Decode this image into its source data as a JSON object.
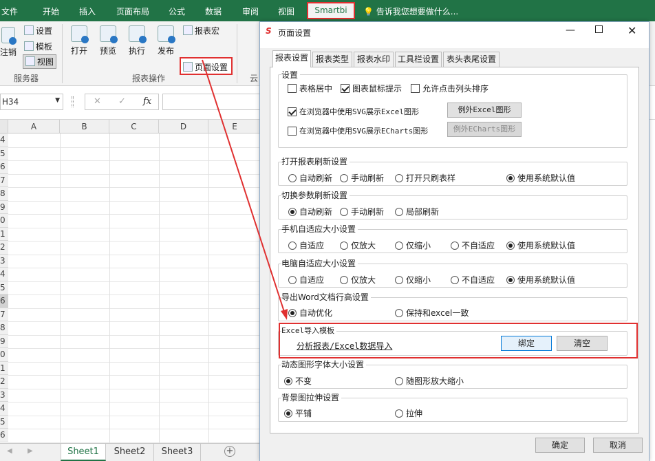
{
  "ribbon_tabs": [
    "文件",
    "开始",
    "插入",
    "页面布局",
    "公式",
    "数据",
    "审阅",
    "视图"
  ],
  "active_tab": "Smartbi",
  "tell_me": "告诉我您想要做什么...",
  "ribbon": {
    "logout": "注销",
    "settings": "设置",
    "template": "模板",
    "view": "视图",
    "group_server": "服务器",
    "open": "打开",
    "preview": "预览",
    "execute": "执行",
    "publish": "发布",
    "report_macro": "报表宏",
    "page_setup": "页面设置",
    "group_report_ops": "报表操作",
    "cloud_initial": "云"
  },
  "name_box": "H34",
  "fx": "fx",
  "columns": [
    "A",
    "B",
    "C",
    "D",
    "E"
  ],
  "row_numbers": [
    "4",
    "5",
    "6",
    "7",
    "8",
    "9",
    "0",
    "1",
    "2",
    "3",
    "4",
    "5",
    "6",
    "7",
    "8",
    "9",
    "0",
    "1",
    "2",
    "3",
    "4",
    "5",
    "6"
  ],
  "sheets": [
    "Sheet1",
    "Sheet2",
    "Sheet3"
  ],
  "dialog": {
    "title": "页面设置",
    "tabs": [
      "报表设置",
      "报表类型",
      "报表水印",
      "工具栏设置",
      "表头表尾设置"
    ],
    "settings_group": "设置",
    "chk_center": "表格居中",
    "chk_tooltip": "图表鼠标提示",
    "chk_sort": "允许点击列头排序",
    "chk_svg_excel": "在浏览器中使用SVG展示Excel图形",
    "btn_except_excel": "例外Excel图形",
    "chk_svg_echarts": "在浏览器中使用SVG展示ECharts图形",
    "btn_except_echarts": "例外ECharts图形",
    "open_refresh": {
      "label": "打开报表刷新设置",
      "opts": [
        "自动刷新",
        "手动刷新",
        "打开只刷表样",
        "使用系统默认值"
      ]
    },
    "param_refresh": {
      "label": "切换参数刷新设置",
      "opts": [
        "自动刷新",
        "手动刷新",
        "局部刷新"
      ]
    },
    "mobile_fit": {
      "label": "手机自适应大小设置",
      "opts": [
        "自适应",
        "仅放大",
        "仅缩小",
        "不自适应",
        "使用系统默认值"
      ]
    },
    "pc_fit": {
      "label": "电脑自适应大小设置",
      "opts": [
        "自适应",
        "仅放大",
        "仅缩小",
        "不自适应",
        "使用系统默认值"
      ]
    },
    "word_export": {
      "label": "导出Word文档行高设置",
      "opts": [
        "自动优化",
        "保持和excel一致"
      ]
    },
    "excel_import": {
      "label": "Excel导入模板",
      "link": "分析报表/Excel数据导入",
      "bind": "绑定",
      "clear": "清空"
    },
    "chart_font": {
      "label": "动态图形字体大小设置",
      "opts": [
        "不变",
        "随图形放大缩小"
      ]
    },
    "bg_stretch": {
      "label": "背景图拉伸设置",
      "opts": [
        "平铺",
        "拉伸"
      ]
    },
    "ok": "确定",
    "cancel": "取消"
  },
  "colors": {
    "excel_green": "#217346",
    "highlight_red": "#e03030",
    "selected_tab_bg": "#f3f3f3"
  }
}
